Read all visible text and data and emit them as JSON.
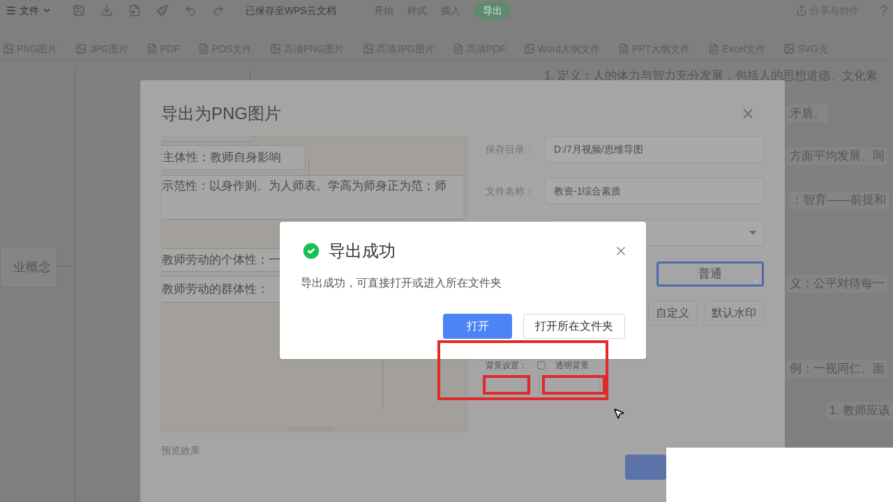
{
  "toolbar": {
    "menu_label": "文件",
    "save_status": "已保存至WPS云文档",
    "tabs": [
      {
        "label": "开始",
        "selected": false
      },
      {
        "label": "样式",
        "selected": false
      },
      {
        "label": "插入",
        "selected": false
      },
      {
        "label": "导出",
        "selected": true
      }
    ],
    "share": "分享与协作",
    "help": "?"
  },
  "export_formats": [
    {
      "label": "PNG图片",
      "kind": "image"
    },
    {
      "label": "JPG图片",
      "kind": "image"
    },
    {
      "label": "PDF",
      "kind": "document"
    },
    {
      "label": "POS文件",
      "kind": "document"
    },
    {
      "label": "高清PNG图片",
      "kind": "image"
    },
    {
      "label": "高清JPG图片",
      "kind": "image"
    },
    {
      "label": "高清PDF",
      "kind": "document"
    },
    {
      "label": "Word大纲文件",
      "kind": "image"
    },
    {
      "label": "PPT大纲文件",
      "kind": "document"
    },
    {
      "label": "Excel文件",
      "kind": "document"
    },
    {
      "label": "SVG无",
      "kind": "image"
    }
  ],
  "mindmap": {
    "root": "业概念",
    "top_note": "1. 定义：人的体力与智力充分发展，包括人的思想道德、文化素",
    "right_nodes": [
      "矛盾。",
      "方面平均发展、同",
      "：智育——前提和",
      "义：公平对待每一",
      "例：一视同仁、面",
      "1. 教师应该"
    ]
  },
  "export_dialog": {
    "title": "导出为PNG图片",
    "preview_nodes": [
      "主体性：教师自身影响",
      "示范性：以身作则。为人师表。学高为师身正为范；师",
      "教师劳动的个体性：一",
      "教师劳动的群体性："
    ],
    "preview_label": "预览效果",
    "save_dir": {
      "label": "保存目录：",
      "value": "D:/7月视频/思维导图"
    },
    "file_name": {
      "label": "文件名称：",
      "value": "教资-1综合素质"
    },
    "quality_options": [
      {
        "label": "普通",
        "selected": true
      }
    ],
    "watermark_buttons": [
      "自定义",
      "默认水印"
    ],
    "background": {
      "label": "背景设置：",
      "option": "透明背景",
      "checked": false
    }
  },
  "success_dialog": {
    "title": "导出成功",
    "message": "导出成功，可直接打开或进入所在文件夹",
    "buttons": [
      {
        "label": "打开",
        "kind": "primary"
      },
      {
        "label": "打开所在文件夹",
        "kind": "secondary"
      }
    ]
  }
}
